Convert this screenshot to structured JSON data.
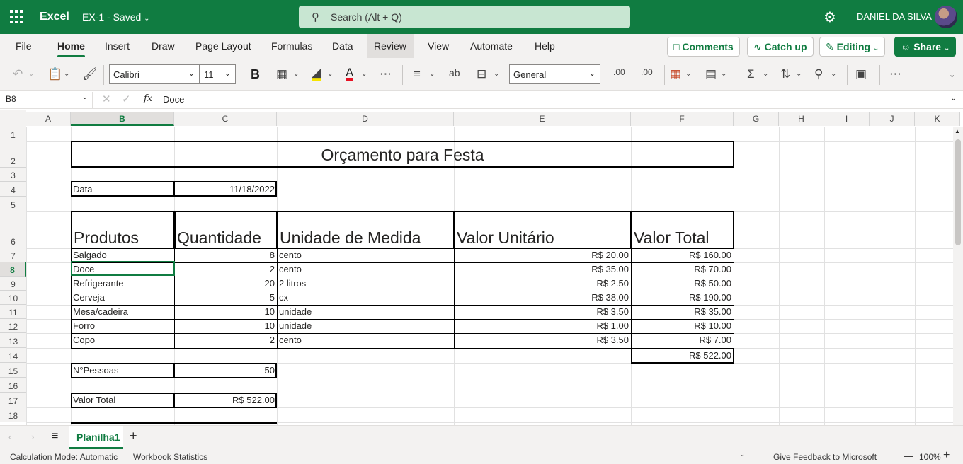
{
  "app": {
    "name": "Excel",
    "doc_name": "EX-1",
    "doc_status": "Saved",
    "search_placeholder": "Search (Alt + Q)",
    "user_name": "DANIEL DA SILVA",
    "brand_color": "#107c41"
  },
  "tabs": [
    "File",
    "Home",
    "Insert",
    "Draw",
    "Page Layout",
    "Formulas",
    "Data",
    "Review",
    "View",
    "Automate",
    "Help"
  ],
  "active_tab": "Home",
  "ribbon_right": {
    "comments": "Comments",
    "catch_up": "Catch up",
    "editing": "Editing",
    "share": "Share"
  },
  "ribbon": {
    "font_name": "Calibri",
    "font_size": "11",
    "number_format": "General"
  },
  "formula_bar": {
    "name_box": "B8",
    "fx": "fx",
    "content": "Doce"
  },
  "columns": [
    "A",
    "B",
    "C",
    "D",
    "E",
    "F",
    "G",
    "H",
    "I",
    "J",
    "K"
  ],
  "rows": [
    "1",
    "2",
    "3",
    "4",
    "5",
    "6",
    "7",
    "8",
    "9",
    "10",
    "11",
    "12",
    "13",
    "14",
    "15",
    "16",
    "17",
    "18"
  ],
  "selected_cell": "B8",
  "sheet": {
    "title": "Orçamento para Festa",
    "date_label": "Data",
    "date_value": "11/18/2022",
    "headers": [
      "Produtos",
      "Quantidade",
      "Unidade de Medida",
      "Valor Unitário",
      "Valor Total"
    ],
    "items": [
      [
        "Salgado",
        "8",
        "cento",
        "R$ 20.00",
        "R$ 160.00"
      ],
      [
        "Doce",
        "2",
        "cento",
        "R$ 35.00",
        "R$ 70.00"
      ],
      [
        "Refrigerante",
        "20",
        "2 litros",
        "R$ 2.50",
        "R$ 50.00"
      ],
      [
        "Cerveja",
        "5",
        "cx",
        "R$ 38.00",
        "R$ 190.00"
      ],
      [
        "Mesa/cadeira",
        "10",
        "unidade",
        "R$ 3.50",
        "R$ 35.00"
      ],
      [
        "Forro",
        "10",
        "unidade",
        "R$ 1.00",
        "R$ 10.00"
      ],
      [
        "Copo",
        "2",
        "cento",
        "R$ 3.50",
        "R$ 7.00"
      ]
    ],
    "sum_total": "R$ 522.00",
    "people_label": "N°Pessoas",
    "people_value": "50",
    "total_label": "Valor Total",
    "total_value": "R$ 522.00"
  },
  "sheet_tabs": {
    "active": "Planilha1"
  },
  "status": {
    "calc_mode": "Calculation Mode: Automatic",
    "workbook_stats": "Workbook Statistics",
    "feedback": "Give Feedback to Microsoft",
    "zoom": "100%"
  }
}
